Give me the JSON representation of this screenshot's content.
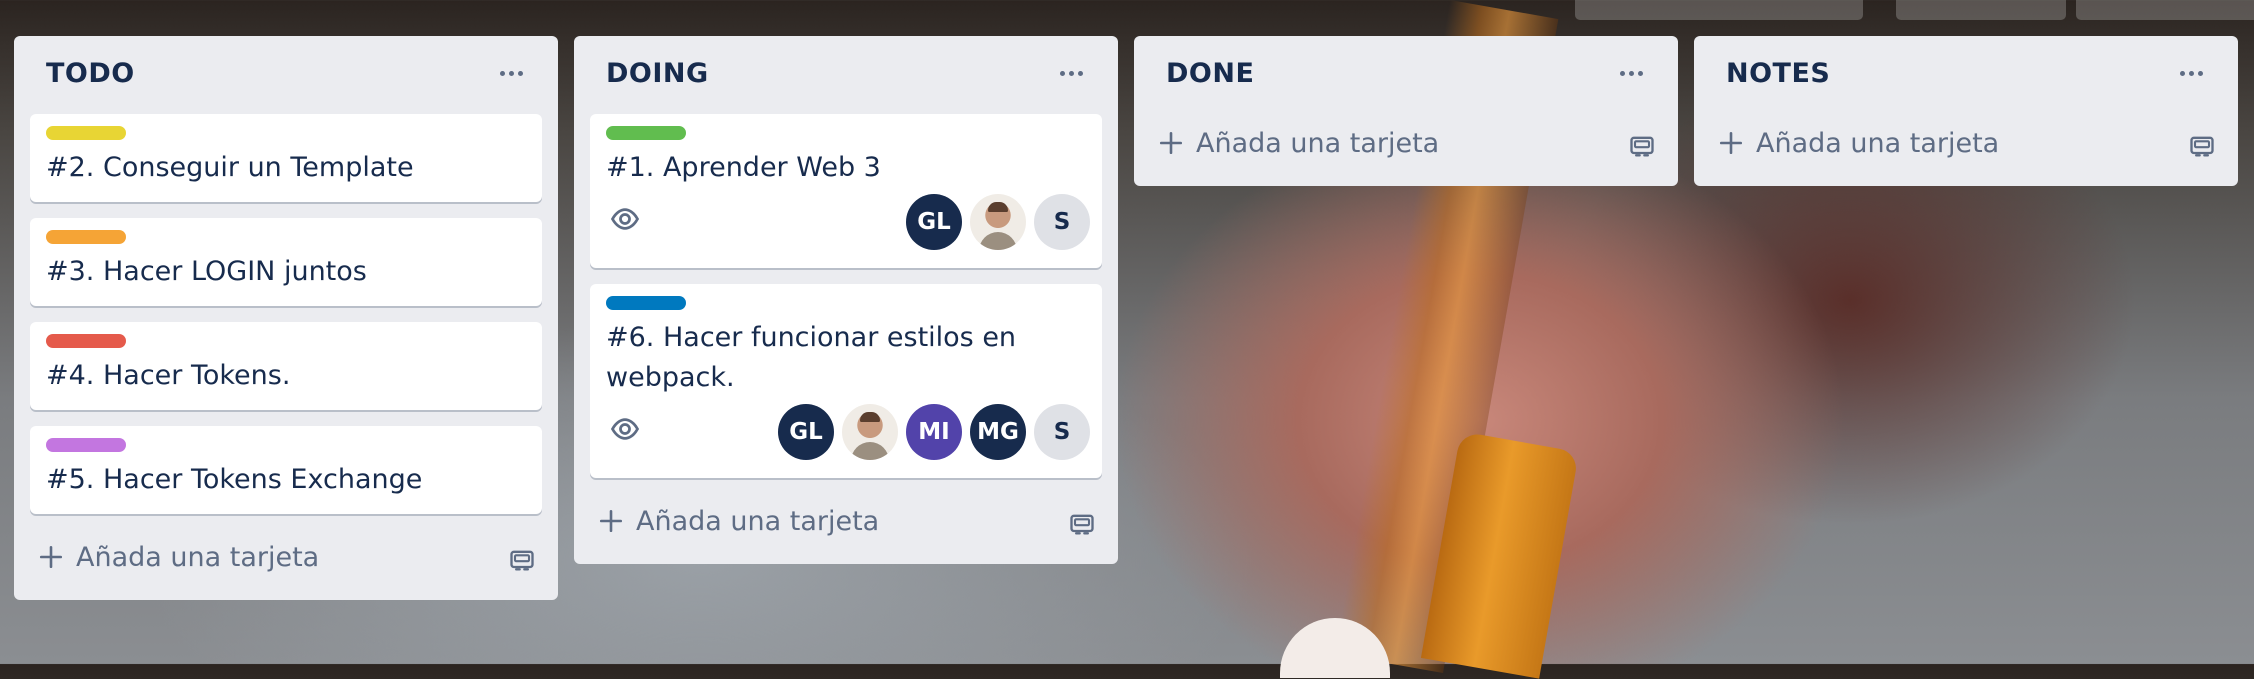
{
  "board": {
    "lists": [
      {
        "title": "TODO",
        "cards": [
          {
            "label_color": "#e8d534",
            "title": "#2. Conseguir un Template"
          },
          {
            "label_color": "#f5a436",
            "title": "#3. Hacer LOGIN juntos"
          },
          {
            "label_color": "#e55a4b",
            "title": "#4. Hacer Tokens."
          },
          {
            "label_color": "#c376e0",
            "title": "#5. Hacer Tokens Exchange"
          }
        ],
        "add_card_label": "Añada una tarjeta"
      },
      {
        "title": "DOING",
        "cards": [
          {
            "label_color": "#61bd4f",
            "title": "#1. Aprender Web 3",
            "watch_icon": "eye-icon",
            "members": [
              {
                "initials": "GL",
                "color": "#172b4d"
              },
              {
                "initials": "",
                "color": "photo"
              },
              {
                "initials": "S",
                "color": "#dfe1e6"
              }
            ]
          },
          {
            "label_color": "#0079bf",
            "title": "#6. Hacer funcionar estilos en webpack.",
            "watch_icon": "eye-icon",
            "members": [
              {
                "initials": "GL",
                "color": "#172b4d"
              },
              {
                "initials": "",
                "color": "photo"
              },
              {
                "initials": "MI",
                "color": "#5243aa"
              },
              {
                "initials": "MG",
                "color": "#172b4d"
              },
              {
                "initials": "S",
                "color": "#dfe1e6"
              }
            ]
          }
        ],
        "add_card_label": "Añada una tarjeta"
      },
      {
        "title": "DONE",
        "cards": [],
        "add_card_label": "Añada una tarjeta"
      },
      {
        "title": "NOTES",
        "cards": [],
        "add_card_label": "Añada una tarjeta"
      }
    ]
  }
}
